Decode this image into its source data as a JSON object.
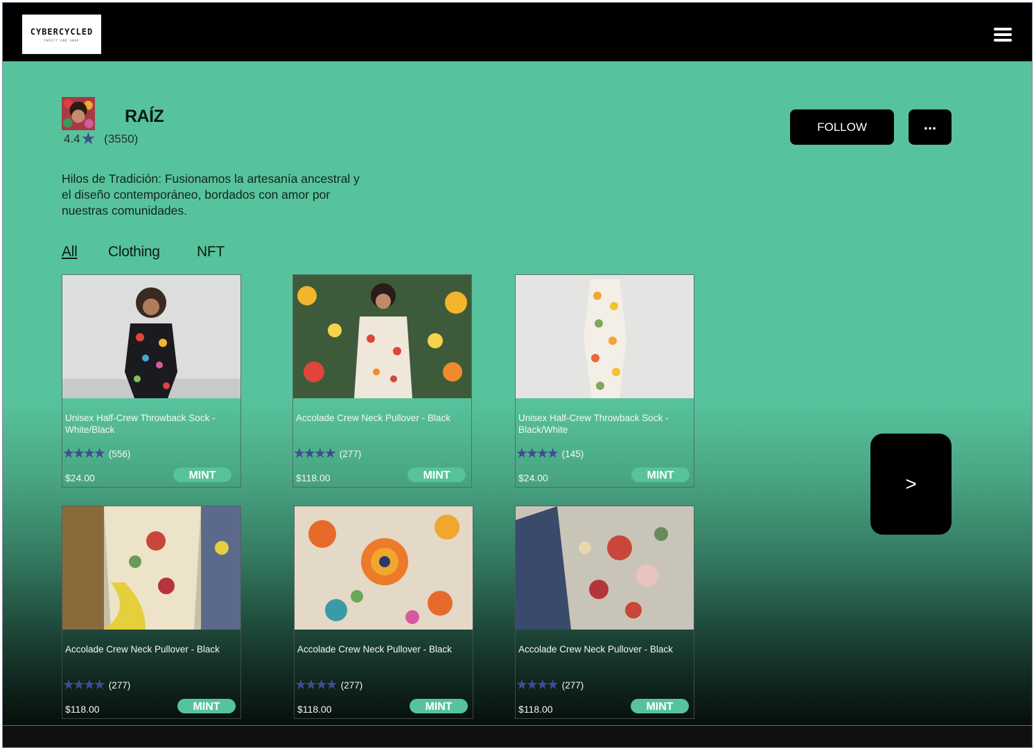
{
  "header": {
    "logo_title": "CYBERCYCLED",
    "logo_subtitle": "THRIFT AND SWAP",
    "menu_icon": "hamburger-menu-icon"
  },
  "shop": {
    "name": "RAÍZ",
    "rating": "4.4",
    "rating_count": "(3550)",
    "description": "Hilos de Tradición: Fusionamos la artesanía ancestral y el diseño contemporáneo, bordados con amor por nuestras comunidades.",
    "follow_label": "FOLLOW",
    "more_label": "..."
  },
  "tabs": [
    {
      "label": "All",
      "active": true
    },
    {
      "label": "Clothing",
      "active": false
    },
    {
      "label": "NFT",
      "active": false
    }
  ],
  "products": [
    {
      "name": "Unisex Half-Crew Throwback Sock - White/Black",
      "reviews": "(556)",
      "price": "$24.00",
      "action": "MINT"
    },
    {
      "name": "Accolade Crew Neck Pullover - Black",
      "reviews": "(277)",
      "price": "$118.00",
      "action": "MINT"
    },
    {
      "name": "Unisex Half-Crew Throwback Sock - Black/White",
      "reviews": "(145)",
      "price": "$24.00",
      "action": "MINT"
    },
    {
      "name": "Accolade Crew Neck Pullover - Black",
      "reviews": "(277)",
      "price": "$118.00",
      "action": "MINT"
    },
    {
      "name": "Accolade Crew Neck Pullover - Black",
      "reviews": "(277)",
      "price": "$118.00",
      "action": "MINT"
    },
    {
      "name": "Accolade Crew Neck Pullover - Black",
      "reviews": "(277)",
      "price": "$118.00",
      "action": "MINT"
    }
  ],
  "next_label": ">",
  "colors": {
    "accent": "#57c39c",
    "star": "#3e4d8f",
    "button": "#000000"
  }
}
